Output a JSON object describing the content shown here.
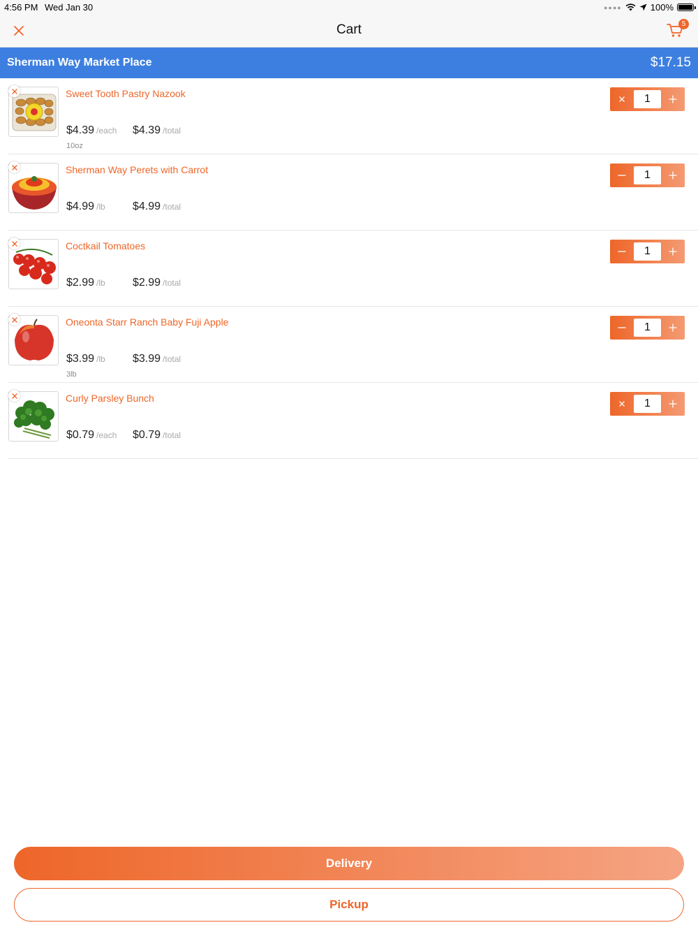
{
  "status_bar": {
    "time": "4:56 PM",
    "date": "Wed Jan 30",
    "battery": "100%"
  },
  "nav": {
    "title": "Cart",
    "cart_count": "5"
  },
  "store": {
    "name": "Sherman Way Market Place",
    "total": "$17.15"
  },
  "colors": {
    "accent": "#ee6629",
    "store_bar": "#3d7fe0"
  },
  "items": [
    {
      "name": "Sweet Tooth Pastry Nazook",
      "unit_price": "$4.39",
      "unit_suffix": "/each",
      "total_price": "$4.39",
      "total_suffix": "/total",
      "size": "10oz",
      "qty": "1",
      "decrement_icon": "times-icon",
      "thumb": "pastry-box"
    },
    {
      "name": "Sherman Way Perets with Carrot",
      "unit_price": "$4.99",
      "unit_suffix": "/lb",
      "total_price": "$4.99",
      "total_suffix": "/total",
      "size": "",
      "qty": "1",
      "decrement_icon": "minus-icon",
      "thumb": "pepper-bowl"
    },
    {
      "name": "Coctkail Tomatoes",
      "unit_price": "$2.99",
      "unit_suffix": "/lb",
      "total_price": "$2.99",
      "total_suffix": "/total",
      "size": "",
      "qty": "1",
      "decrement_icon": "minus-icon",
      "thumb": "tomatoes"
    },
    {
      "name": "Oneonta Starr Ranch Baby Fuji Apple",
      "unit_price": "$3.99",
      "unit_suffix": "/lb",
      "total_price": "$3.99",
      "total_suffix": "/total",
      "size": "3lb",
      "qty": "1",
      "decrement_icon": "minus-icon",
      "thumb": "apple"
    },
    {
      "name": "Curly Parsley Bunch",
      "unit_price": "$0.79",
      "unit_suffix": "/each",
      "total_price": "$0.79",
      "total_suffix": "/total",
      "size": "",
      "qty": "1",
      "decrement_icon": "times-icon",
      "thumb": "parsley"
    }
  ],
  "actions": {
    "delivery": "Delivery",
    "pickup": "Pickup"
  }
}
